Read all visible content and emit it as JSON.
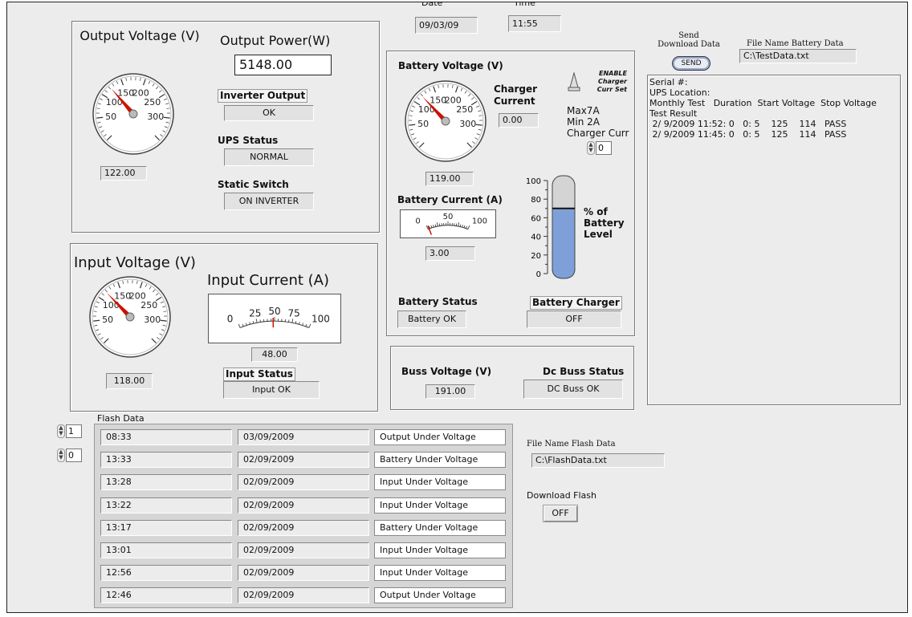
{
  "output_voltage": {
    "title": "Output Voltage (V)",
    "value": "122.00",
    "gauge_ticks": [
      "50",
      "100",
      "150",
      "200",
      "250",
      "300"
    ]
  },
  "output_power": {
    "title": "Output Power(W)",
    "value": "5148.00"
  },
  "inverter_output": {
    "label": "Inverter Output",
    "value": "OK"
  },
  "ups_status": {
    "label": "UPS Status",
    "value": "NORMAL"
  },
  "static_switch": {
    "label": "Static Switch",
    "value": "ON INVERTER"
  },
  "date": {
    "label": "Date",
    "value": "09/03/09"
  },
  "time": {
    "label": "Time",
    "value": "11:55"
  },
  "battery_voltage": {
    "title": "Battery Voltage (V)",
    "value": "119.00",
    "gauge_ticks": [
      "50",
      "100",
      "150",
      "200",
      "250",
      "300"
    ]
  },
  "charger_current": {
    "label": "Charger Current",
    "value": "0.00"
  },
  "enable_charger": {
    "label": "ENABLE Charger Curr Set",
    "max": "Max7A",
    "min": "Min 2A",
    "curr_label": "Charger Curr",
    "curr_value": "0"
  },
  "battery_current": {
    "title": "Battery Current (A)",
    "value": "3.00",
    "meter_ticks": [
      "0",
      "50",
      "100"
    ]
  },
  "battery_level": {
    "label": "% of Battery Level",
    "percent": 70,
    "ticks": [
      "100",
      "80",
      "60",
      "40",
      "20",
      "0"
    ]
  },
  "battery_status": {
    "label": "Battery Status",
    "value": "Battery OK"
  },
  "battery_charger": {
    "label": "Battery Charger",
    "value": "OFF"
  },
  "input_voltage": {
    "title": "Input Voltage (V)",
    "value": "118.00",
    "gauge_ticks": [
      "50",
      "100",
      "150",
      "200",
      "250",
      "300"
    ]
  },
  "input_current": {
    "title": "Input Current (A)",
    "value": "48.00",
    "meter_ticks": [
      "0",
      "25",
      "50",
      "75",
      "100"
    ]
  },
  "input_status": {
    "label": "Input Status",
    "value": "Input OK"
  },
  "buss_voltage": {
    "label": "Buss Voltage (V)",
    "value": "191.00"
  },
  "dc_buss_status": {
    "label": "Dc Buss Status",
    "value": "DC Buss OK"
  },
  "send_download": {
    "label": "Send Download Data",
    "button": "SEND"
  },
  "file_battery": {
    "label": "File Name Battery Data",
    "value": "C:\\TestData.txt"
  },
  "log_text": {
    "lines": [
      "Serial #:",
      "UPS Location:",
      "Monthly Test   Duration  Start Voltage  Stop Voltage",
      "Test Result",
      " 2/ 9/2009 11:52: 0   0: 5    125    114   PASS",
      " 2/ 9/2009 11:45: 0   0: 5    125    114   PASS"
    ]
  },
  "flash": {
    "label": "Flash Data",
    "stepper1": "1",
    "stepper2": "0",
    "rows": [
      {
        "time": "08:33",
        "date": "03/09/2009",
        "event": "Output Under Voltage"
      },
      {
        "time": "13:33",
        "date": "02/09/2009",
        "event": "Battery Under Voltage"
      },
      {
        "time": "13:28",
        "date": "02/09/2009",
        "event": "Input Under Voltage"
      },
      {
        "time": "13:22",
        "date": "02/09/2009",
        "event": "Input Under Voltage"
      },
      {
        "time": "13:17",
        "date": "02/09/2009",
        "event": "Battery Under Voltage"
      },
      {
        "time": "13:01",
        "date": "02/09/2009",
        "event": "Input Under Voltage"
      },
      {
        "time": "12:56",
        "date": "02/09/2009",
        "event": "Input Under Voltage"
      },
      {
        "time": "12:46",
        "date": "02/09/2009",
        "event": "Output Under Voltage"
      }
    ]
  },
  "file_flash": {
    "label": "File Name Flash Data",
    "value": "C:\\FlashData.txt"
  },
  "download_flash": {
    "label": "Download Flash",
    "button": "OFF"
  },
  "colors": {
    "needle": "#cc1100",
    "level_fill": "#7f9fd8",
    "panel_bg": "#ececec"
  }
}
